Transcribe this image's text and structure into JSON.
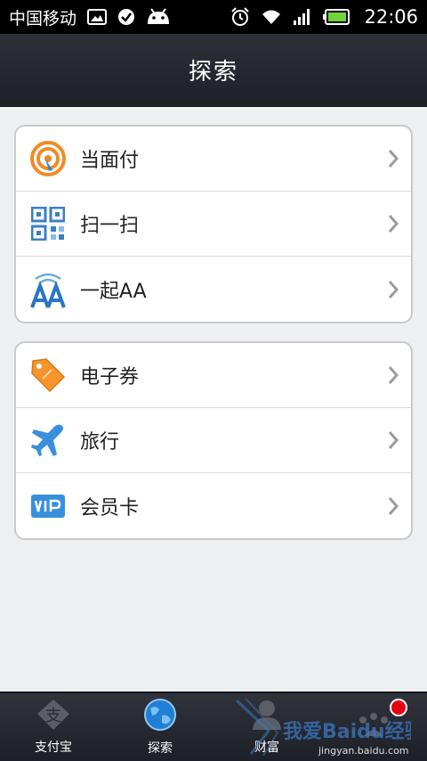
{
  "status_bar": {
    "carrier": "中国移动",
    "time": "22:06"
  },
  "header": {
    "title": "探索"
  },
  "groups": [
    {
      "items": [
        {
          "label": "当面付",
          "icon": "pay-in-person-icon"
        },
        {
          "label": "扫一扫",
          "icon": "qr-scan-icon"
        },
        {
          "label": "一起AA",
          "icon": "aa-split-icon"
        }
      ]
    },
    {
      "items": [
        {
          "label": "电子券",
          "icon": "coupon-tag-icon"
        },
        {
          "label": "旅行",
          "icon": "airplane-icon"
        },
        {
          "label": "会员卡",
          "icon": "vip-card-icon"
        }
      ]
    }
  ],
  "tabs": [
    {
      "label": "支付宝",
      "icon": "alipay-icon"
    },
    {
      "label": "探索",
      "icon": "globe-icon",
      "active": true
    },
    {
      "label": "财富",
      "icon": "wealth-person-icon"
    },
    {
      "label": "",
      "icon": "more-icon"
    }
  ],
  "watermark": {
    "text": "我爱Baidu经验",
    "subtext": "jingyan.baidu.com"
  },
  "colors": {
    "header_bg": "#23262d",
    "accent_orange": "#f08a24",
    "accent_blue": "#2b86d6",
    "badge_red": "#e40010"
  }
}
